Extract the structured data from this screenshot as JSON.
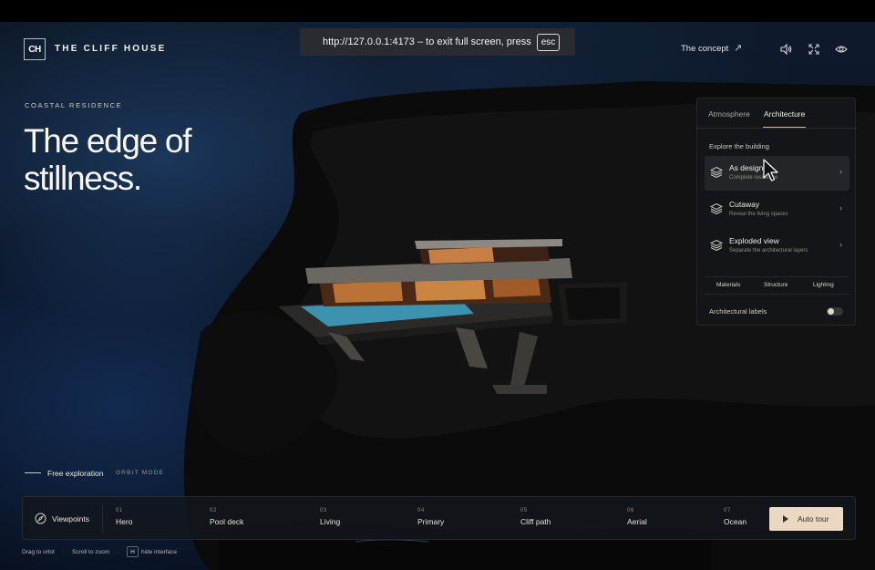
{
  "browser": {
    "fullscreen_message": "http://127.0.0.1:4173 – to exit full screen, press",
    "esc_key": "esc"
  },
  "header": {
    "logo": "CH",
    "brand": "THE CLIFF HOUSE",
    "concept_link": "The concept",
    "icons": [
      "arrow-up-right-icon",
      "speaker-icon",
      "fullscreen-icon",
      "eye-icon"
    ]
  },
  "hero": {
    "eyebrow": "COASTAL RESIDENCE",
    "title_line1": "The edge of",
    "title_line2": "stillness."
  },
  "panel": {
    "tabs": [
      {
        "label": "Atmosphere",
        "active": false
      },
      {
        "label": "Architecture",
        "active": true
      }
    ],
    "section_title": "Explore the building",
    "modes": [
      {
        "name": "As designed",
        "description": "Complete residence",
        "selected": true,
        "icon": "layers-icon"
      },
      {
        "name": "Cutaway",
        "description": "Reveal the living spaces",
        "selected": false,
        "icon": "layers-icon"
      },
      {
        "name": "Exploded view",
        "description": "Separate the architectural layers",
        "selected": false,
        "icon": "layers-icon"
      }
    ],
    "layers": [
      "Materials",
      "Structure",
      "Lighting"
    ],
    "labels_toggle": {
      "label": "Architectural labels",
      "on": false
    }
  },
  "exploration": {
    "label": "Free exploration",
    "mode": "ORBIT MODE"
  },
  "viewpoints": {
    "label": "Viewpoints",
    "items": [
      {
        "num": "01",
        "name": "Hero"
      },
      {
        "num": "02",
        "name": "Pool deck"
      },
      {
        "num": "03",
        "name": "Living"
      },
      {
        "num": "04",
        "name": "Primary"
      },
      {
        "num": "05",
        "name": "Cliff path"
      },
      {
        "num": "06",
        "name": "Aerial"
      },
      {
        "num": "07",
        "name": "Ocean"
      }
    ],
    "auto_tour": "Auto tour"
  },
  "hints": {
    "drag": "Drag to orbit",
    "scroll": "Scroll to zoom",
    "key": "H",
    "hide": "hide interface"
  },
  "colors": {
    "accent": "#d7b48a",
    "tour_button": "#ead8c2",
    "panel_bg": "#14161a"
  }
}
